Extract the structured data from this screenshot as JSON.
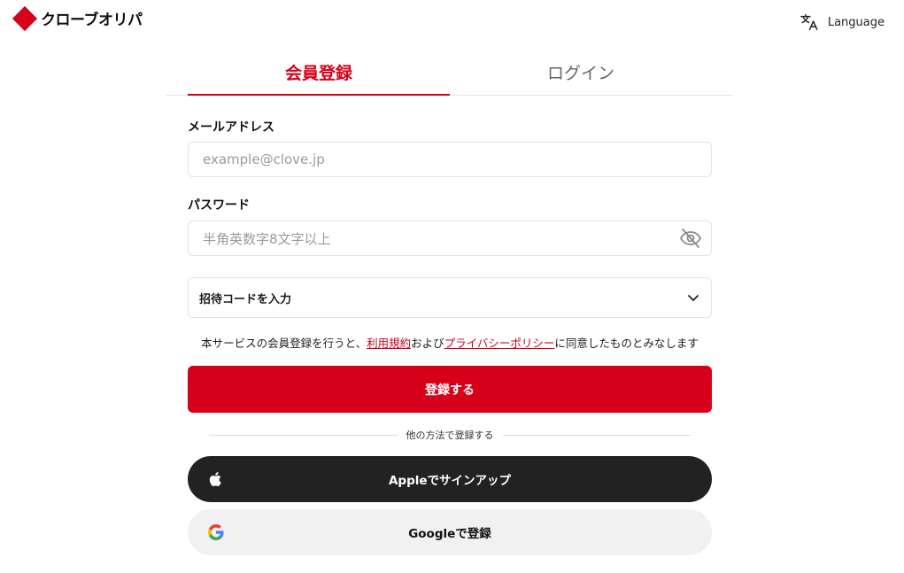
{
  "header": {
    "logo_text": "クローブオリパ",
    "language_label": "Language"
  },
  "tabs": [
    {
      "label": "会員登録",
      "active": true
    },
    {
      "label": "ログイン",
      "active": false
    }
  ],
  "form": {
    "email_label": "メールアドレス",
    "email_placeholder": "example@clove.jp",
    "password_label": "パスワード",
    "password_placeholder": "半角英数字8文字以上",
    "invite_label": "招待コードを入力",
    "terms_prefix": "本サービスの会員登録を行うと、",
    "terms_link": "利用規約",
    "terms_middle": "および",
    "privacy_link": "プライバシーポリシー",
    "terms_suffix": "に同意したものとみなします",
    "submit_label": "登録する"
  },
  "divider_label": "他の方法で登録する",
  "social": {
    "apple_label": "Appleでサインアップ",
    "google_label": "Googleで登録"
  },
  "colors": {
    "accent": "#d7001a",
    "apple_bg": "#222222",
    "google_bg": "#f1f1f1"
  },
  "icons": [
    "logo-icon",
    "translate-icon",
    "eye-off-icon",
    "chevron-down-icon",
    "apple-icon",
    "google-icon"
  ]
}
